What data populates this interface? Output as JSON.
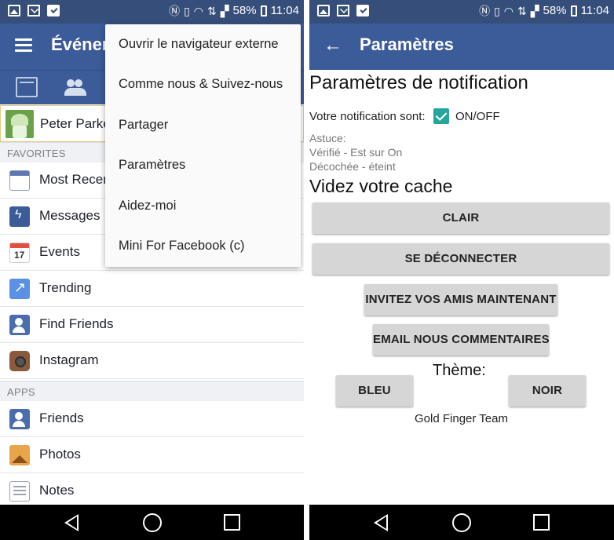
{
  "status_bar": {
    "battery": "58%",
    "time": "11:04"
  },
  "left": {
    "app_bar": {
      "title": "Événem"
    },
    "profile": {
      "name": "Peter Parke"
    },
    "sections": {
      "favorites": "FAVORITES",
      "apps": "APPS"
    },
    "favorites": [
      {
        "label": "Most Recen",
        "icon": "most-recent-icon"
      },
      {
        "label": "Messages",
        "icon": "messages-icon"
      },
      {
        "label": "Events",
        "icon": "events-calendar-icon"
      },
      {
        "label": "Trending",
        "icon": "trending-icon"
      },
      {
        "label": "Find Friends",
        "icon": "find-friends-icon"
      },
      {
        "label": "Instagram",
        "icon": "instagram-icon"
      }
    ],
    "apps": [
      {
        "label": "Friends",
        "icon": "friends-icon"
      },
      {
        "label": "Photos",
        "icon": "photos-icon"
      },
      {
        "label": "Notes",
        "icon": "notes-icon"
      }
    ],
    "overflow_menu": [
      "Ouvrir le navigateur externe",
      "Comme nous & Suivez-nous",
      "Partager",
      "Paramètres",
      "Aidez-moi",
      "Mini For Facebook (c)"
    ]
  },
  "right": {
    "app_bar": {
      "title": "Paramètres"
    },
    "notification_title": "Paramètres de notification",
    "notification_label": "Votre notification sont:",
    "notification_checked": true,
    "onoff_label": "ON/OFF",
    "hint_title": "Astuce:",
    "hint_checked": "Vérifié - Est sur On",
    "hint_unchecked": "Décochée - éteint",
    "cache_title": "Videz votre cache",
    "buttons": {
      "clear": "CLAIR",
      "logout": "SE DÉCONNECTER",
      "invite": "INVITEZ VOS AMIS MAINTENANT",
      "feedback": "EMAIL NOUS COMMENTAIRES",
      "blue": "BLEU",
      "black": "NOIR"
    },
    "theme_label": "Thème:",
    "footer": "Gold Finger Team"
  },
  "colors": {
    "status_bar": "#364e7a",
    "app_bar": "#3b5b99",
    "checkbox": "#26a69a",
    "button_bg": "#d6d6d6"
  }
}
